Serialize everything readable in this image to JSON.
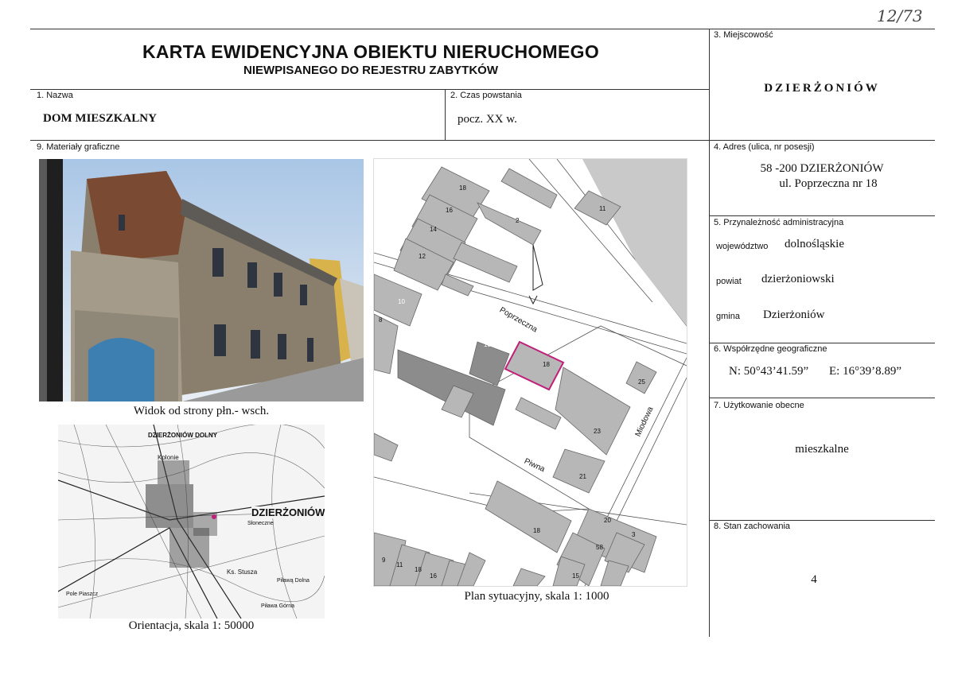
{
  "handwritten_number": "12/73",
  "header": {
    "title": "KARTA EWIDENCYJNA OBIEKTU NIERUCHOMEGO",
    "subtitle": "NIEWPISANEGO DO REJESTRU ZABYTKÓW"
  },
  "fields": {
    "miejscowosc": {
      "label": "3. Miejscowość",
      "value": "DZIERŻONIÓW"
    },
    "nazwa": {
      "label": "1. Nazwa",
      "value": "DOM MIESZKALNY"
    },
    "czas": {
      "label": "2. Czas powstania",
      "value": "pocz. XX w."
    },
    "materialy": {
      "label": "9. Materiały graficzne"
    },
    "adres": {
      "label": "4. Adres (ulica, nr posesji)",
      "line1": "58 -200  DZIERŻONIÓW",
      "line2": "ul. Poprzeczna nr 18"
    },
    "przynaleznosc": {
      "label": "5. Przynależność administracyjna",
      "wojewodztwo_label": "województwo",
      "wojewodztwo": "dolnośląskie",
      "powiat_label": "powiat",
      "powiat": "dzierżoniowski",
      "gmina_label": "gmina",
      "gmina": "Dzierżoniów"
    },
    "wspolrzedne": {
      "label": "6. Współrzędne geograficzne",
      "n": "N: 50°43’41.59”",
      "e": "E: 16°39’8.89”"
    },
    "uzytkowanie": {
      "label": "7. Użytkowanie obecne",
      "value": "mieszkalne"
    },
    "stan": {
      "label": "8. Stan zachowania",
      "value": "4"
    }
  },
  "captions": {
    "photo": "Widok od strony płn.- wsch.",
    "orientation": "Orientacja, skala 1: 50000",
    "plan": "Plan sytuacyjny, skala 1: 1000"
  },
  "plan_labels": {
    "street1": "Poprzeczna",
    "street2": "Piwna",
    "street3": "Miodowa",
    "buildings": [
      "18",
      "16",
      "14",
      "12",
      "2",
      "11",
      "10",
      "8",
      "13",
      "18",
      "25",
      "23",
      "21",
      "18",
      "20",
      "3",
      "58",
      "15",
      "9",
      "11",
      "18",
      "16"
    ]
  },
  "topo_labels": {
    "city": "DZIERŻONIÓW",
    "top_label": "DZIERŻONIÓW DOLNY",
    "labels": [
      "Kolonie",
      "Ks. Stusza",
      "Piławą Dolna",
      "Piława Górna",
      "Słoneczne",
      "Pole Piaszcz"
    ]
  },
  "colors": {
    "lines": "#333333",
    "highlight": "#c0207a"
  }
}
